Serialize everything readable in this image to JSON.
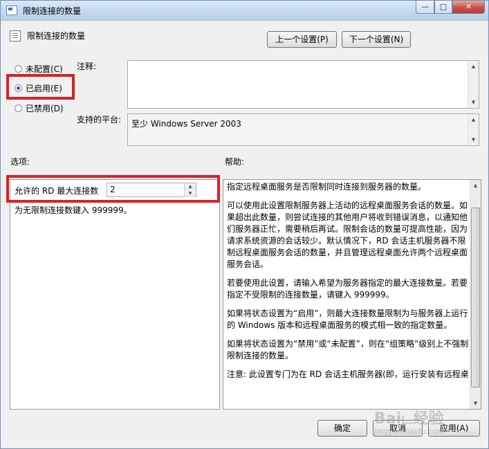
{
  "window": {
    "title": "限制连接的数量",
    "heading": "限制连接的数量",
    "min_glyph": "—",
    "max_glyph": "□",
    "close_glyph": "✕"
  },
  "nav": {
    "prev_label": "上一个设置(P)",
    "next_label": "下一个设置(N)"
  },
  "state": {
    "options": [
      {
        "label": "未配置(C)",
        "selected": false
      },
      {
        "label": "已启用(E)",
        "selected": true
      },
      {
        "label": "已禁用(D)",
        "selected": false
      }
    ]
  },
  "comment": {
    "label": "注释:",
    "value": ""
  },
  "platform": {
    "label": "支持的平台:",
    "value": "至少 Windows Server 2003"
  },
  "options_section": {
    "label": "选项:",
    "max_connections_label": "允许的 RD 最大连接数",
    "max_connections_value": "2",
    "hint": "为无限制连接数键入 999999。"
  },
  "help_section": {
    "label": "帮助:",
    "paragraphs": [
      "指定远程桌面服务是否限制同时连接到服务器的数量。",
      "可以使用此设置限制服务器上活动的远程桌面服务会话的数量。如果超出此数量，则尝试连接的其他用户将收到错误消息，以通知他们服务器正忙，需要稍后再试。限制会话的数量可提高性能，因为请求系统资源的会话较少。默认情况下，RD 会话主机服务器不限制远程桌面服务会话的数量，并且管理远程桌面允许两个远程桌面服务会话。",
      "若要使用此设置，请输入希望为服务器指定的最大连接数量。若要指定不受限制的连接数量，请键入 999999。",
      "如果将状态设置为“启用”，则最大连接数量限制为与服务器上运行的 Windows 版本和远程桌面服务的模式相一致的指定数量。",
      "如果将状态设置为“禁用”或“未配置”，则在“组策略”级别上不强制限制连接的数量。",
      "注意: 此设置专门为在 RD 会话主机服务器(即，运行安装有远程桌"
    ]
  },
  "footer": {
    "ok_label": "确定",
    "cancel_label": "取消",
    "apply_label": "应用(A)"
  },
  "watermark": {
    "text": "Baiட经验",
    "sub": "jingyan.baidu.com"
  }
}
